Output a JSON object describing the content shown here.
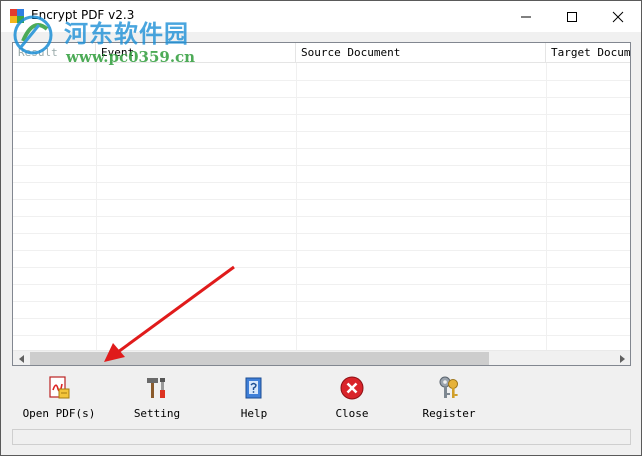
{
  "window": {
    "title": "Encrypt PDF v2.3"
  },
  "watermark": {
    "site_name": "河东软件园",
    "url": "www.pc0359.cn"
  },
  "list": {
    "columns": [
      "Result",
      "Event",
      "Source Document",
      "Target Document"
    ]
  },
  "toolbar": {
    "buttons": [
      {
        "label": "Open PDF(s)",
        "icon": "open-pdf-icon"
      },
      {
        "label": "Setting",
        "icon": "tools-icon"
      },
      {
        "label": "Help",
        "icon": "help-book-icon"
      },
      {
        "label": "Close",
        "icon": "close-circle-icon"
      },
      {
        "label": "Register",
        "icon": "keys-icon"
      }
    ]
  },
  "colors": {
    "annotation_arrow": "#e01b1b",
    "close_icon_red": "#d9242a",
    "watermark_blue": "#1c8fd6",
    "watermark_green": "#2e9d3a"
  }
}
